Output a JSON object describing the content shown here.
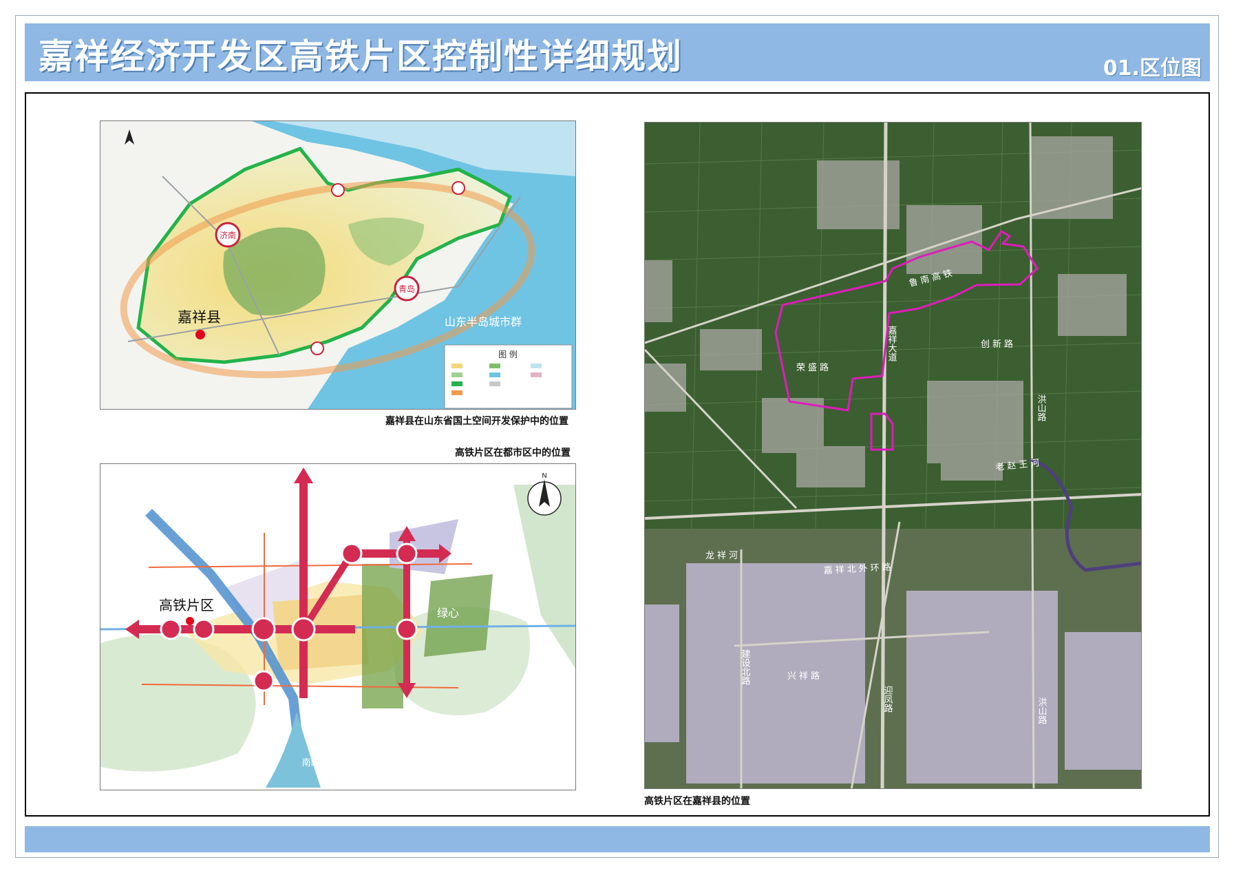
{
  "header": {
    "title": "嘉祥经济开发区高铁片区控制性详细规划",
    "sheet_label": "01.区位图"
  },
  "colors": {
    "header_bg": "#8fb8e4",
    "boundary": "#e01bbd",
    "city_marker": "#d42b52",
    "location_dot": "#e3051b"
  },
  "map1": {
    "caption": "嘉祥县在山东省国土空间开发保护中的位置",
    "place_label": "嘉祥县",
    "region_label": "山东半岛城市群",
    "cities": [
      "济南",
      "青岛"
    ],
    "legend_title": "图 例"
  },
  "map2": {
    "caption": "高铁片区在都市区中的位置",
    "place_label": "高铁片区",
    "green_core": "绿心",
    "lake": "南四湖"
  },
  "map3": {
    "caption": "高铁片区在嘉祥县的位置",
    "railway": "鲁南高铁",
    "roads": {
      "jiaxiang_ave": "嘉祥大道",
      "rongsheng": "荣盛路",
      "chuangxin": "创新路",
      "hongshan": "洪山路",
      "laozhaowang": "老赵王河",
      "longxiang": "龙祥河",
      "north_ring": "嘉祥北外环路",
      "jianshe_north": "建设北路",
      "xingxiang": "兴祥路",
      "yingfeng": "迎凤路"
    }
  }
}
